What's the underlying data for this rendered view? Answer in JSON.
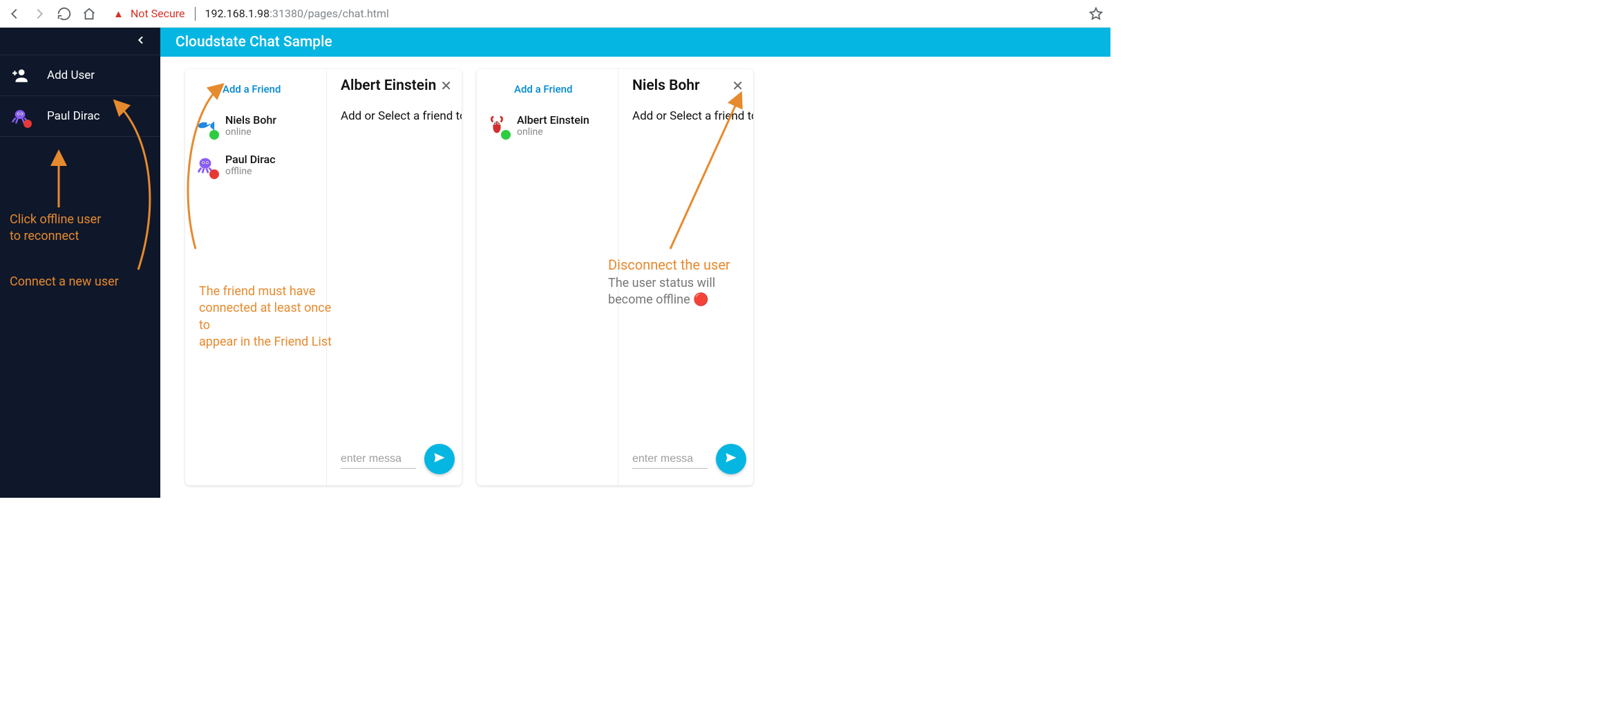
{
  "browser": {
    "not_secure": "Not Secure",
    "url_host": "192.168.1.98",
    "url_port_path": ":31380/pages/chat.html"
  },
  "sidebar": {
    "add_user": "Add User",
    "users": [
      {
        "name": "Paul Dirac",
        "status": "offline",
        "avatar": "octopus",
        "dot": "red"
      }
    ]
  },
  "header": {
    "title": "Cloudstate Chat Sample"
  },
  "cards": [
    {
      "add_friend_label": "Add a Friend",
      "friends": [
        {
          "name": "Niels Bohr",
          "status": "online",
          "avatar": "fish",
          "dot": "green"
        },
        {
          "name": "Paul Dirac",
          "status": "offline",
          "avatar": "octopus",
          "dot": "red"
        }
      ],
      "chat": {
        "title": "Albert Einstein",
        "hint": "Add or Select a friend to",
        "placeholder": "enter messa"
      }
    },
    {
      "add_friend_label": "Add a Friend",
      "friends": [
        {
          "name": "Albert Einstein",
          "status": "online",
          "avatar": "lobster",
          "dot": "green"
        }
      ],
      "chat": {
        "title": "Niels Bohr",
        "hint": "Add or Select a friend to",
        "placeholder": "enter messa"
      }
    }
  ],
  "annotations": {
    "sidebar_reconnect": "Click offline user\nto reconnect",
    "sidebar_connect_new": "Connect a new user",
    "friend_hint": "The friend must have\nconnected at least once to\nappear in the Friend List",
    "disconnect_title": "Disconnect the user",
    "disconnect_sub": "The user status will\nbecome offline 🔴"
  },
  "colors": {
    "accent": "#06b6e2",
    "sidebar_bg": "#0f172a",
    "annotation": "#e68a2e",
    "online": "#2ecc40",
    "offline": "#e53935"
  }
}
